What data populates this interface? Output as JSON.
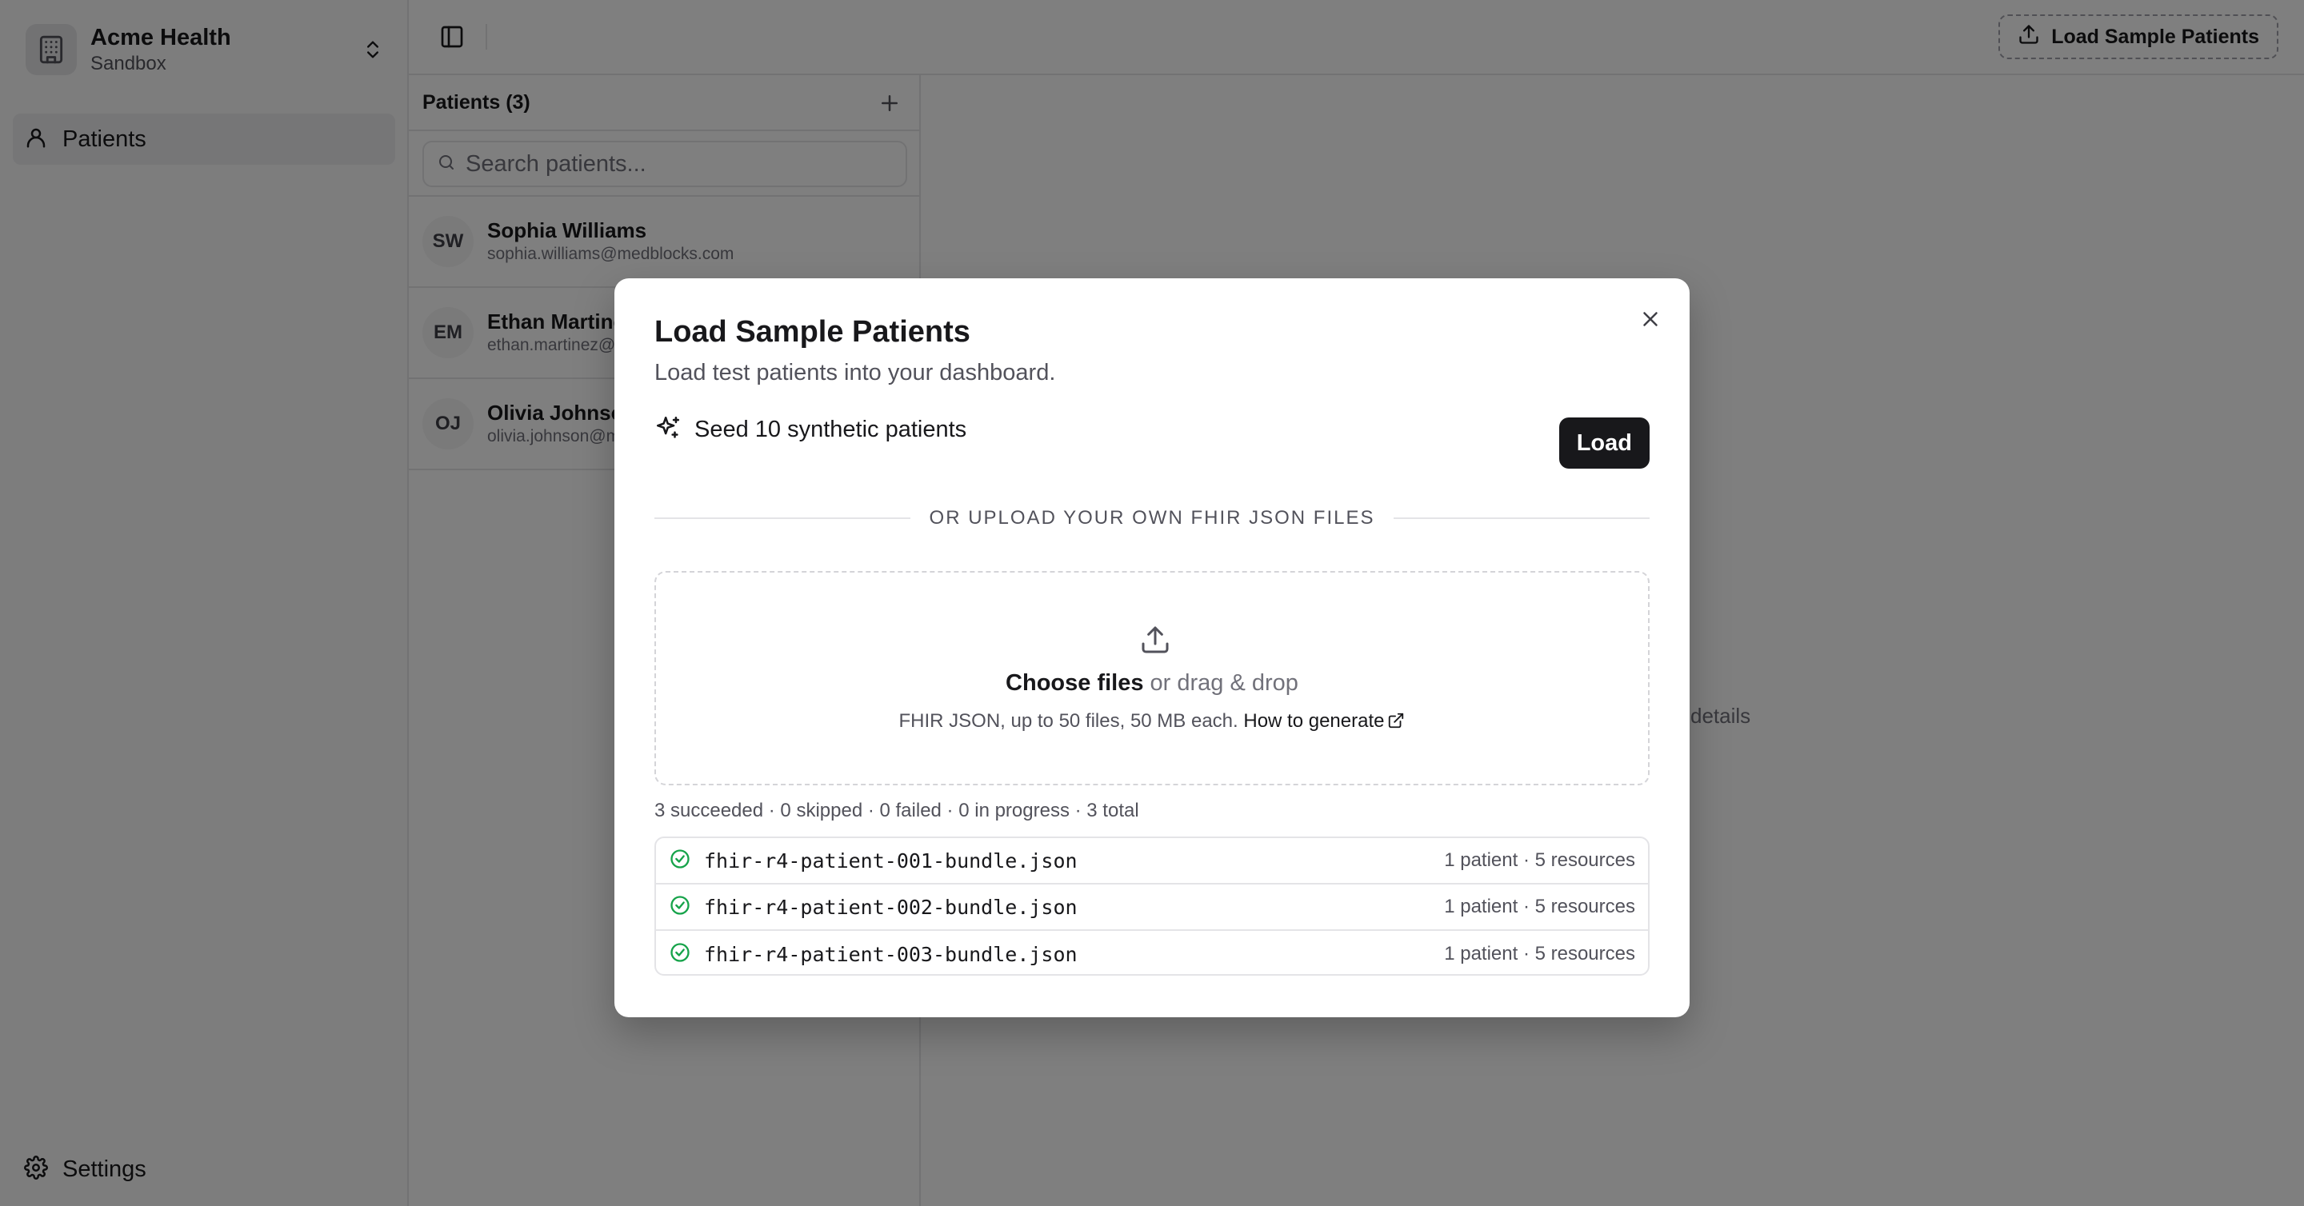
{
  "org": {
    "name": "Acme Health",
    "environment": "Sandbox"
  },
  "sidebar": {
    "items": [
      {
        "label": "Patients",
        "icon": "user-icon"
      }
    ],
    "settings_label": "Settings"
  },
  "topbar": {
    "load_sample_label": "Load Sample Patients"
  },
  "patients_panel": {
    "title": "Patients (3)",
    "search_placeholder": "Search patients...",
    "patients": [
      {
        "initials": "SW",
        "name": "Sophia Williams",
        "email": "sophia.williams@medblocks.com"
      },
      {
        "initials": "EM",
        "name": "Ethan Martinez",
        "email": "ethan.martinez@medblocks.com"
      },
      {
        "initials": "OJ",
        "name": "Olivia Johnson",
        "email": "olivia.johnson@medblocks.com"
      }
    ]
  },
  "detail_hint_visible": "details",
  "dialog": {
    "title": "Load Sample Patients",
    "description": "Load test patients into your dashboard.",
    "seed_label": "Seed 10 synthetic patients",
    "load_button": "Load",
    "divider_text": "OR UPLOAD YOUR OWN FHIR JSON FILES",
    "dropzone": {
      "choose_label": "Choose files",
      "drag_label": " or drag & drop",
      "hint": "FHIR JSON, up to 50 files, 50 MB each. ",
      "howto_label": "How to generate"
    },
    "summary": "3 succeeded · 0 skipped · 0 failed · 0 in progress · 3 total",
    "files": [
      {
        "name": "fhir-r4-patient-001-bundle.json",
        "meta": "1 patient · 5 resources",
        "status": "success"
      },
      {
        "name": "fhir-r4-patient-002-bundle.json",
        "meta": "1 patient · 5 resources",
        "status": "success"
      },
      {
        "name": "fhir-r4-patient-003-bundle.json",
        "meta": "1 patient · 5 resources",
        "status": "success"
      }
    ]
  },
  "colors": {
    "success": "#16a34a",
    "primary": "#18181b",
    "muted": "#71717a",
    "border": "#e4e4e7"
  }
}
